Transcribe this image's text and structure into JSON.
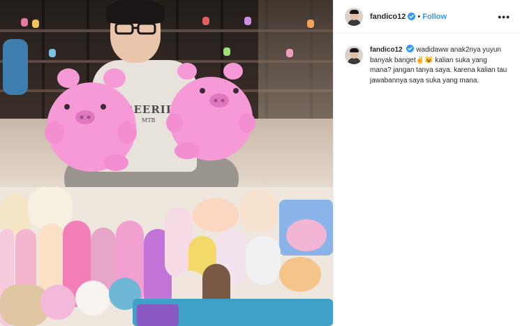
{
  "post": {
    "author": {
      "username": "fandico12",
      "verified": true,
      "follow_label": "Follow",
      "separator": "•"
    },
    "more_label": "•••",
    "caption": {
      "username": "fandico12",
      "text": "wadidaww anak2nya yuyun banyak banget✌😺 kalian suka yang mana? jangan tanya saya. karena kalian tau jawabannya saya suka yang mana."
    },
    "photo": {
      "shirt_text": "REERII",
      "shirt_subtext": "MTB"
    }
  },
  "colors": {
    "link_blue": "#3897f0",
    "verified_blue": "#3897f0",
    "text": "#262626",
    "divider": "#efefef"
  },
  "icons": {
    "verified": "verified-badge-icon",
    "more": "more-options-icon"
  }
}
